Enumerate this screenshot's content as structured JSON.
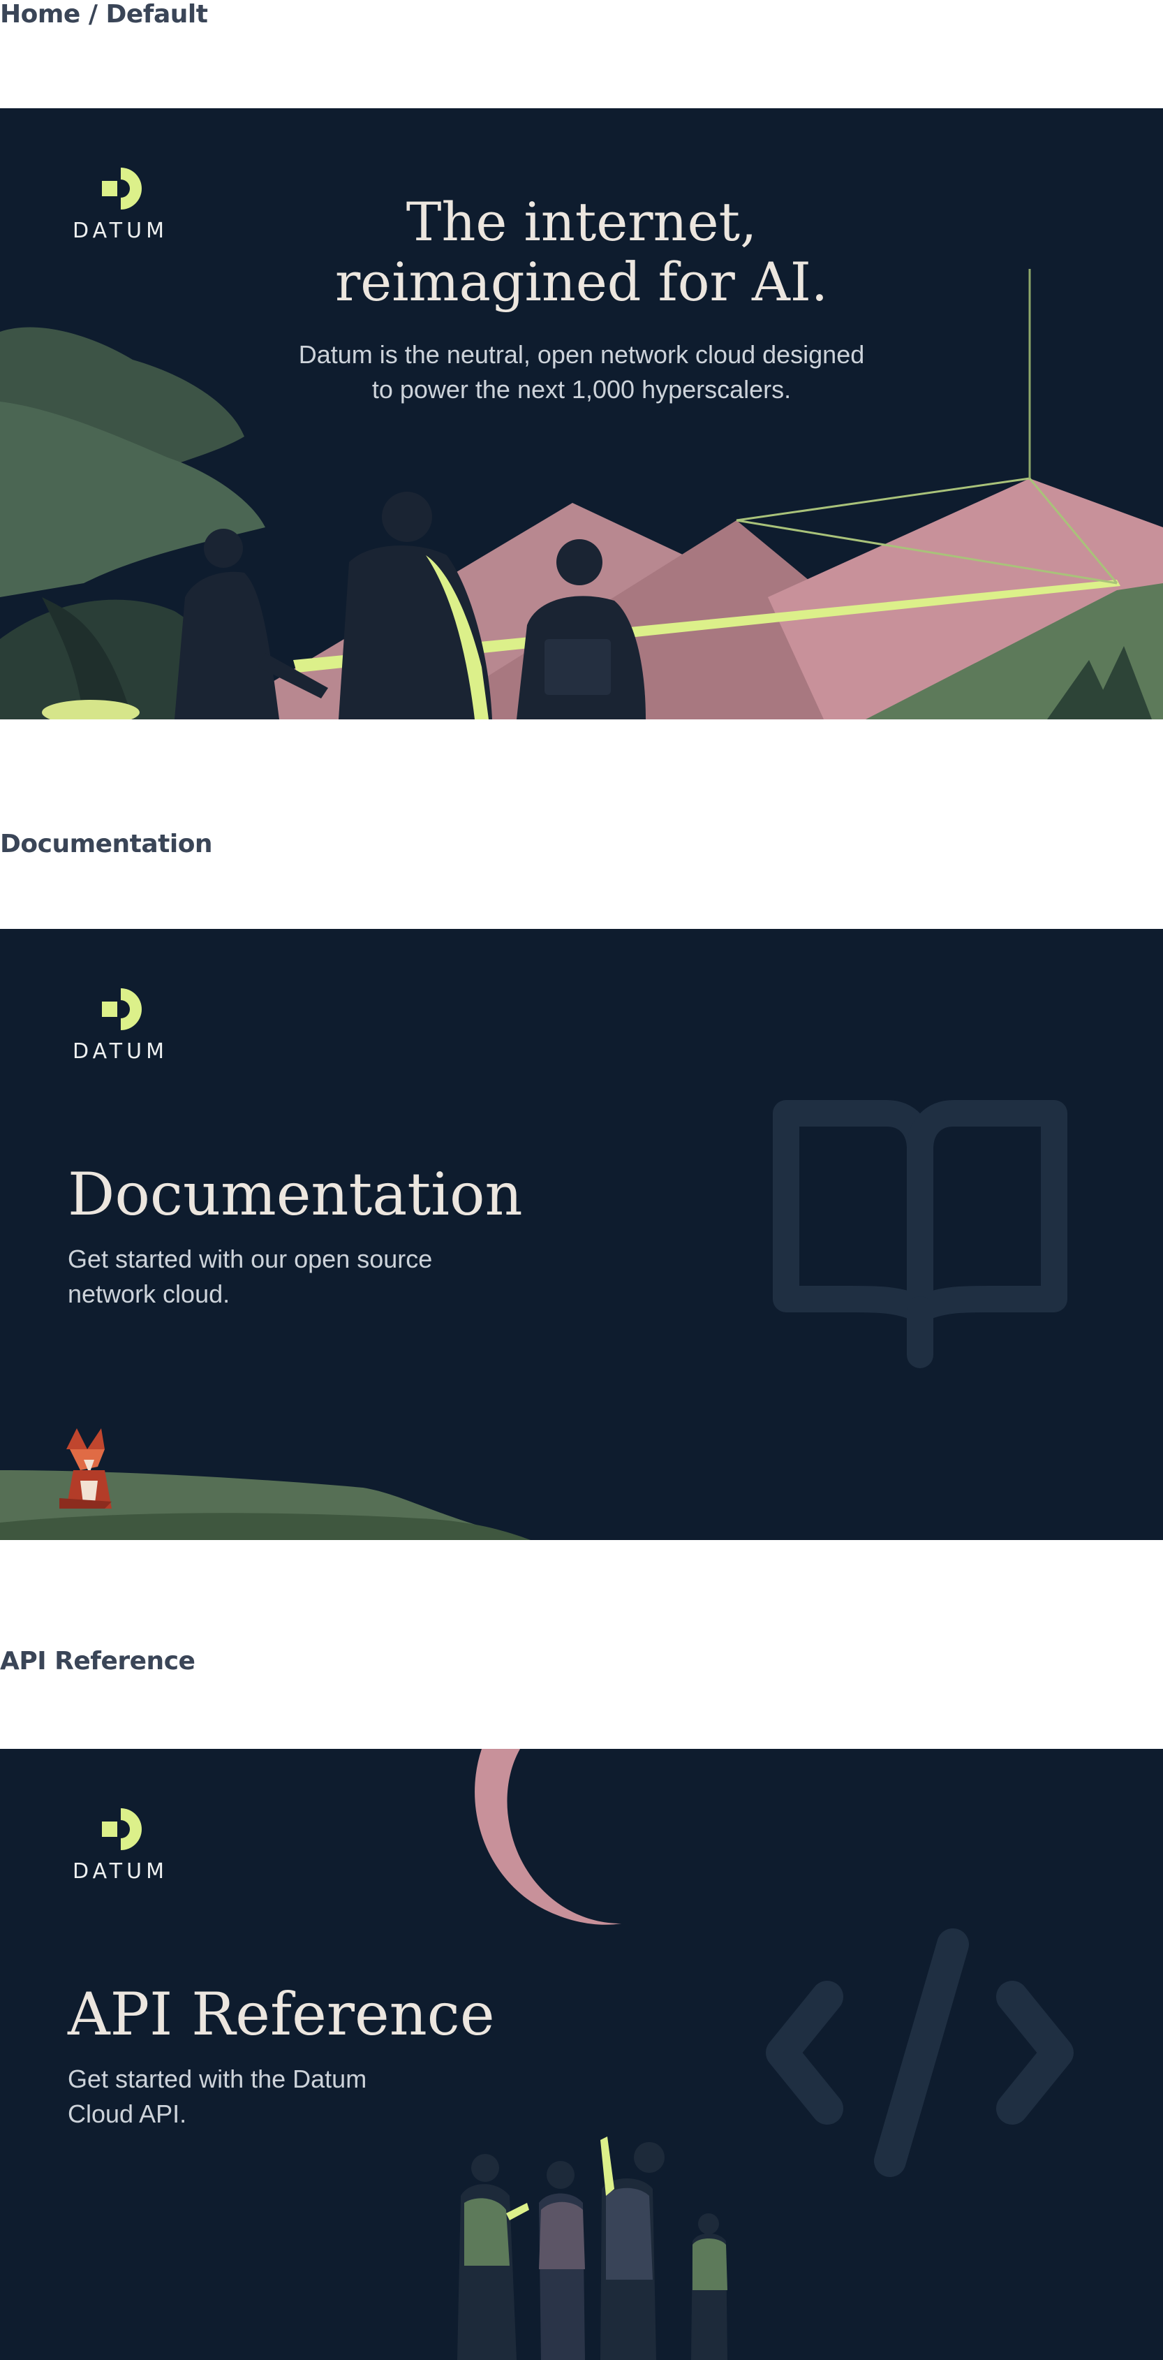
{
  "breadcrumb": {
    "text": "Home / Default"
  },
  "hero": {
    "logo_text": "DATUM",
    "title_line1": "The internet,",
    "title_line2": "reimagined for AI.",
    "subtitle_line1": "Datum is the neutral, open network cloud designed",
    "subtitle_line2": "to power the next 1,000 hyperscalers."
  },
  "documentation": {
    "section_label": "Documentation",
    "logo_text": "DATUM",
    "title": "Documentation",
    "subtitle_line1": "Get started with our open source",
    "subtitle_line2": "network cloud.",
    "icon": "book-icon"
  },
  "api_reference": {
    "section_label": "API Reference",
    "logo_text": "DATUM",
    "title": "API Reference",
    "subtitle_line1": "Get started with the Datum",
    "subtitle_line2": "Cloud API.",
    "icon": "code-icon"
  },
  "colors": {
    "card_background": "#0e1c2e",
    "accent": "#dcf08a",
    "mountain_pink": "#c8919a",
    "hill_green": "#5d7a5a",
    "label_text": "#3a4557"
  }
}
